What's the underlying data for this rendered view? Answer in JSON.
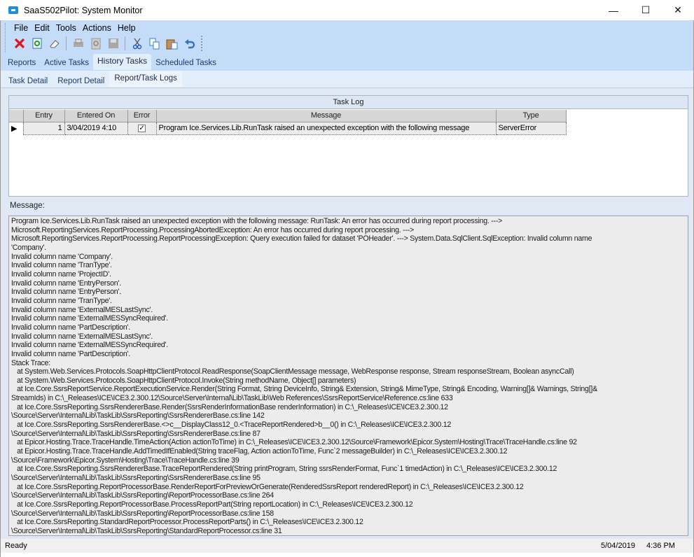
{
  "window": {
    "title": "SaaS502Pilot: System Monitor",
    "minimize": "—",
    "maximize": "☐",
    "close": "✕"
  },
  "menu": [
    "File",
    "Edit",
    "Tools",
    "Actions",
    "Help"
  ],
  "toolbar": [
    "delete-icon",
    "refresh-icon",
    "clear-icon",
    "print-icon",
    "print-preview-icon",
    "save-icon",
    "cut-icon",
    "copy-icon",
    "paste-icon",
    "undo-icon"
  ],
  "tabs": [
    "Reports",
    "Active Tasks",
    "History Tasks",
    "Scheduled Tasks"
  ],
  "active_tab": "History Tasks",
  "subtabs": [
    "Task Detail",
    "Report Detail",
    "Report/Task Logs"
  ],
  "active_subtab": "Report/Task Logs",
  "task_log": {
    "title": "Task Log",
    "columns": [
      "Entry",
      "Entered On",
      "Error",
      "Message",
      "Type"
    ],
    "rows": [
      {
        "entry": "1",
        "entered_on": "3/04/2019 4:10",
        "error": "✓",
        "message": "Program Ice.Services.Lib.RunTask raised an unexpected exception with the following message",
        "type": "ServerError"
      }
    ]
  },
  "message": {
    "label": "Message:",
    "lines": [
      "Program Ice.Services.Lib.RunTask raised an unexpected exception with the following message: RunTask: An error has occurred during report processing. --->",
      "Microsoft.ReportingServices.ReportProcessing.ProcessingAbortedException: An error has occurred during report processing. --->",
      "Microsoft.ReportingServices.ReportProcessing.ReportProcessingException: Query execution failed for dataset 'POHeader'. ---> System.Data.SqlClient.SqlException: Invalid column name",
      "'Company'.",
      "Invalid column name 'Company'.",
      "Invalid column name 'TranType'.",
      "Invalid column name 'ProjectID'.",
      "Invalid column name 'EntryPerson'.",
      "Invalid column name 'EntryPerson'.",
      "Invalid column name 'TranType'.",
      "Invalid column name 'ExternalMESLastSync'.",
      "Invalid column name 'ExternalMESSyncRequired'.",
      "Invalid column name 'PartDescription'.",
      "Invalid column name 'ExternalMESLastSync'.",
      "Invalid column name 'ExternalMESSyncRequired'.",
      "Invalid column name 'PartDescription'.",
      "Stack Trace:",
      "   at System.Web.Services.Protocols.SoapHttpClientProtocol.ReadResponse(SoapClientMessage message, WebResponse response, Stream responseStream, Boolean asyncCall)",
      "   at System.Web.Services.Protocols.SoapHttpClientProtocol.Invoke(String methodName, Object[] parameters)",
      "   at Ice.Core.SsrsReportService.ReportExecutionService.Render(String Format, String DeviceInfo, String& Extension, String& MimeType, String& Encoding, Warning[]& Warnings, String[]&",
      "StreamIds) in C:\\_Releases\\ICE\\ICE3.2.300.12\\Source\\Server\\Internal\\Lib\\TaskLib\\Web References\\SsrsReportService\\Reference.cs:line 633",
      "   at Ice.Core.SsrsReporting.SsrsRendererBase.Render(SsrsRenderInformationBase renderInformation) in C:\\_Releases\\ICE\\ICE3.2.300.12",
      "\\Source\\Server\\Internal\\Lib\\TaskLib\\SsrsReporting\\SsrsRendererBase.cs:line 142",
      "   at Ice.Core.SsrsReporting.SsrsRendererBase.<>c__DisplayClass12_0.<TraceReportRendered>b__0() in C:\\_Releases\\ICE\\ICE3.2.300.12",
      "\\Source\\Server\\Internal\\Lib\\TaskLib\\SsrsReporting\\SsrsRendererBase.cs:line 87",
      "   at Epicor.Hosting.Trace.TraceHandle.TimeAction(Action actionToTime) in C:\\_Releases\\ICE\\ICE3.2.300.12\\Source\\Framework\\Epicor.System\\Hosting\\Trace\\TraceHandle.cs:line 92",
      "   at Epicor.Hosting.Trace.TraceHandle.AddTimedIfEnabled(String traceFlag, Action actionToTime, Func`2 messageBuilder) in C:\\_Releases\\ICE\\ICE3.2.300.12",
      "\\Source\\Framework\\Epicor.System\\Hosting\\Trace\\TraceHandle.cs:line 39",
      "   at Ice.Core.SsrsReporting.SsrsRendererBase.TraceReportRendered(String printProgram, String ssrsRenderFormat, Func`1 timedAction) in C:\\_Releases\\ICE\\ICE3.2.300.12",
      "\\Source\\Server\\Internal\\Lib\\TaskLib\\SsrsReporting\\SsrsRendererBase.cs:line 95",
      "   at Ice.Core.SsrsReporting.ReportProcessorBase.RenderReportForPreviewOrGenerate(RenderedSsrsReport renderedReport) in C:\\_Releases\\ICE\\ICE3.2.300.12",
      "\\Source\\Server\\Internal\\Lib\\TaskLib\\SsrsReporting\\ReportProcessorBase.cs:line 264",
      "   at Ice.Core.SsrsReporting.ReportProcessorBase.ProcessReportPart(String reportLocation) in C:\\_Releases\\ICE\\ICE3.2.300.12",
      "\\Source\\Server\\Internal\\Lib\\TaskLib\\SsrsReporting\\ReportProcessorBase.cs:line 158",
      "   at Ice.Core.SsrsReporting.StandardReportProcessor.ProcessReportParts() in C:\\_Releases\\ICE\\ICE3.2.300.12",
      "\\Source\\Server\\Internal\\Lib\\TaskLib\\SsrsReporting\\StandardReportProcessor.cs:line 31"
    ]
  },
  "status": {
    "text": "Ready",
    "date": "5/04/2019",
    "time": "4:36 PM"
  }
}
